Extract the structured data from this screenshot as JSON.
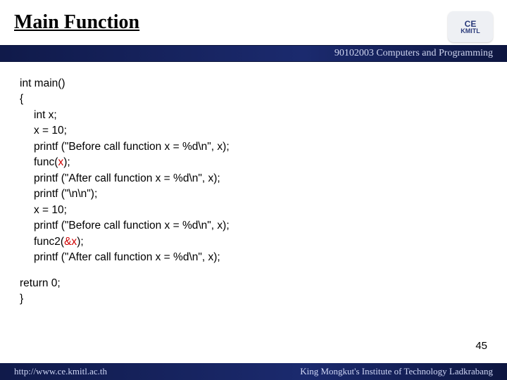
{
  "header": {
    "title": "Main Function",
    "logo": {
      "line1": "CE",
      "line2": "KMITL"
    },
    "course": "90102003 Computers and Programming"
  },
  "code": {
    "l01": "int main()",
    "l02": "{",
    "l03": "int x;",
    "l04": "x = 10;",
    "l05": "printf (\"Before call function x = %d\\n\", x);",
    "l06a": "func(",
    "l06b": "x",
    "l06c": ");",
    "l07": "printf (\"After call function x = %d\\n\", x);",
    "l08": "printf (\"\\n\\n\");",
    "l09": "x = 10;",
    "l10": "printf (\"Before call function x = %d\\n\", x);",
    "l11a": "func2(",
    "l11b": "&x",
    "l11c": ");",
    "l12": "printf (\"After call function x = %d\\n\", x);",
    "l13": "return 0;",
    "l14": "}"
  },
  "page_number": "45",
  "footer": {
    "url": "http://www.ce.kmitl.ac.th",
    "org": "King Mongkut's Institute of Technology Ladkrabang"
  }
}
